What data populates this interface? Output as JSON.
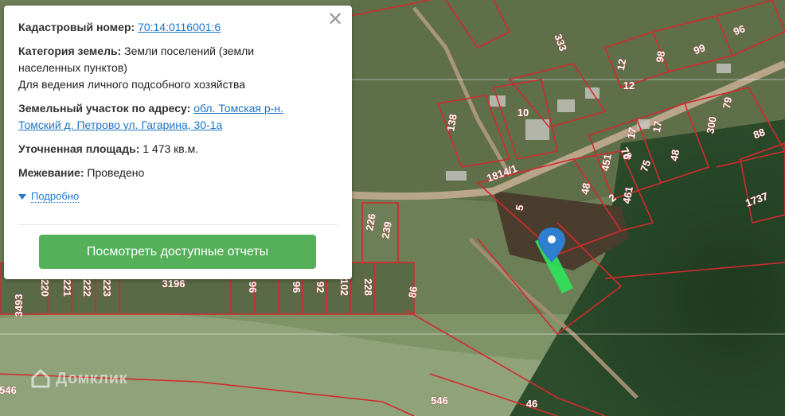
{
  "popup": {
    "cadastral_label": "Кадастровый номер:",
    "cadastral_number": "70:14:0116001:6",
    "category_label": "Категория земель:",
    "category_value": "Земли поселений (земли населенных пунктов)",
    "category_use": "Для ведения личного подсобного хозяйства",
    "address_label": "Земельный участок по адресу:",
    "address_value": "обл. Томская р-н. Томский д. Петрово ул. Гагарина, 30-1а",
    "area_label": "Уточненная площадь:",
    "area_value": "1 473 кв.м.",
    "survey_label": "Межевание:",
    "survey_value": "Проведено",
    "more_label": "Подробно",
    "reports_button": "Посмотреть доступные отчеты",
    "close_icon": "close-icon"
  },
  "watermark": {
    "text": "Домклик",
    "icon": "domclick-logo-icon"
  },
  "map": {
    "plot_color": "#d32a2e",
    "selected_plot_color": "#2ee65a",
    "pin_color": "#2f7fd0",
    "plot_labels": [
      "96",
      "99",
      "98",
      "12",
      "12",
      "333",
      "79",
      "300",
      "88",
      "138",
      "10",
      "17",
      "78",
      "17",
      "48",
      "451",
      "9",
      "75",
      "1814/1",
      "48",
      "461",
      "2",
      "5",
      "1737",
      "226",
      "239",
      "3196",
      "96",
      "96",
      "92",
      "102",
      "228",
      "86",
      "223",
      "222",
      "221",
      "220",
      "3493",
      "546",
      "546",
      "46"
    ]
  }
}
